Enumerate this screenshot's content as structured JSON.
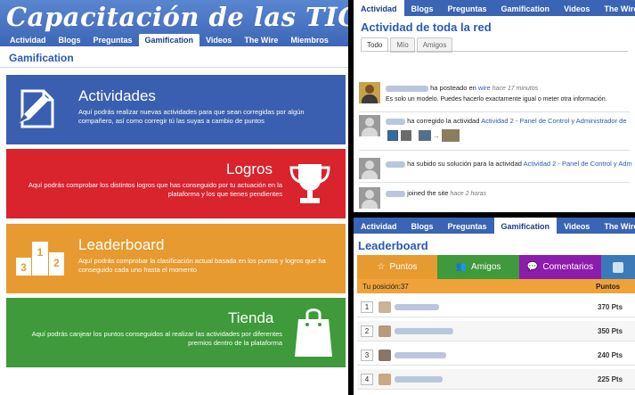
{
  "left": {
    "title": "Capacitación de las TICS",
    "tabs": [
      "Actividad",
      "Blogs",
      "Preguntas",
      "Gamification",
      "Videos",
      "The Wire",
      "Miembros"
    ],
    "active_tab": "Gamification",
    "section_title": "Gamification",
    "cards": [
      {
        "title": "Actividades",
        "description": "Aquí podrás realizar nuevas actividades para que sean corregidas por algún compañero, así como corregir tú las suyas a cambio de puntos",
        "color": "#3a5fb0",
        "icon": "pencil-paper-icon"
      },
      {
        "title": "Logros",
        "description": "Aquí podrás comprobar los distintos logros que has conseguido por tu actuación en la plataforma y los que tienes pendientes",
        "color": "#d9232d",
        "icon": "trophy-icon"
      },
      {
        "title": "Leaderboard",
        "description": "Aquí podrás comprobar la clasificación actual basada en los puntos y logros que ha conseguido cada uno hasta el momento",
        "color": "#e79a2f",
        "icon": "podium-icon",
        "podium_labels": [
          "1",
          "2",
          "3"
        ]
      },
      {
        "title": "Tienda",
        "description": "Aquí podrás canjear los puntos conseguidos al realizar las actividades por diferentes premios dentro de la plataforma",
        "color": "#3e9a3a",
        "icon": "shopping-bag-icon"
      }
    ]
  },
  "activity": {
    "tabs": [
      "Actividad",
      "Blogs",
      "Preguntas",
      "Gamification",
      "Videos",
      "The Wire"
    ],
    "active_tab": "Actividad",
    "heading": "Actividad de toda la red",
    "subtabs": [
      "Todo",
      "Mío",
      "Amigos"
    ],
    "active_subtab": "Todo",
    "items": [
      {
        "action": "ha posteado en",
        "link": "wire",
        "time": "hace 17 minutos",
        "message": "Es solo un modelo. Puedes hacerlo exactamente igual o meter otra información."
      },
      {
        "action": "ha corregido la actividad",
        "link": "Actividad 2 - Panel de Control y Administrador de"
      },
      {
        "action": "ha subido su solución para la actividad",
        "link": "Actividad 2 - Panel de Control y Adm"
      },
      {
        "action": "joined the site",
        "time": "hace 2 horas"
      }
    ]
  },
  "leaderboard": {
    "tabs": [
      "Actividad",
      "Blogs",
      "Preguntas",
      "Gamification",
      "Videos",
      "The Wire"
    ],
    "active_tab": "Gamification",
    "heading": "Leaderboard",
    "lb_tabs": [
      {
        "label": "Puntos",
        "icon": "star-icon",
        "color": "#e79a2f"
      },
      {
        "label": "Amigos",
        "icon": "users-icon",
        "color": "#3e9a3a"
      },
      {
        "label": "Comentarios",
        "icon": "comment-icon",
        "color": "#8d1bab"
      },
      {
        "label": "",
        "icon": "twitter-icon",
        "color": "#3a7ab8"
      }
    ],
    "position_label": "Tu posición:37",
    "points_header": "Puntos",
    "rows": [
      {
        "rank": "1",
        "points": "370 Pts"
      },
      {
        "rank": "2",
        "points": "350 Pts"
      },
      {
        "rank": "3",
        "points": "240 Pts"
      },
      {
        "rank": "4",
        "points": "225 Pts"
      }
    ]
  }
}
